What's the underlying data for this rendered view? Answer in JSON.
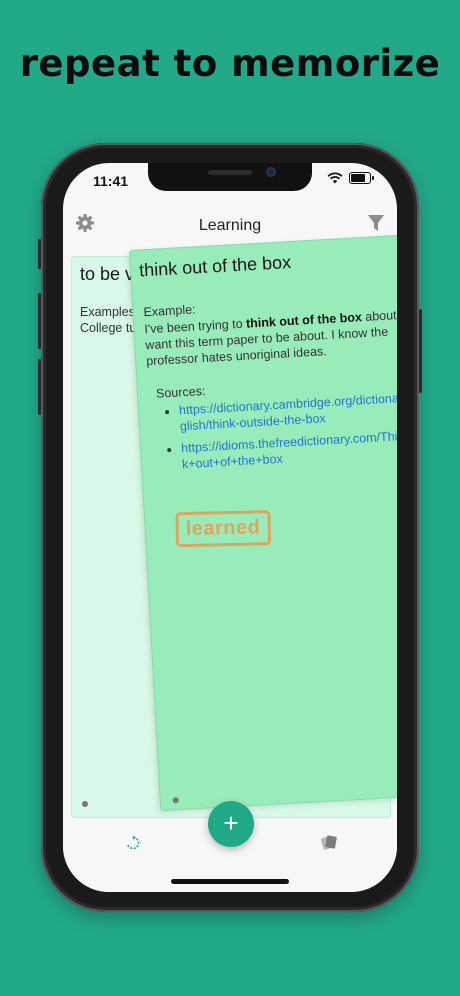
{
  "banner": {
    "headline": "repeat to memorize"
  },
  "status_bar": {
    "time": "11:41"
  },
  "navbar": {
    "title": "Learning",
    "settings_icon": "gear-icon",
    "filter_icon": "filter-icon"
  },
  "back_card": {
    "title_partial": "to be v",
    "body_line1": "Examples",
    "body_line2": "College tu"
  },
  "front_card": {
    "title": "think out of the box",
    "example_label": "Example:",
    "example_prefix": "I've been trying to ",
    "example_bold": "think out of the box",
    "example_suffix": " about what I want this term paper to be about. I know the professor hates unoriginal ideas.",
    "sources_label": "Sources:",
    "sources": [
      "https://dictionary.cambridge.org/dictionary/english/think-outside-the-box",
      "https://idioms.thefreedictionary.com/Think+out+of+the+box"
    ],
    "stamp": "learned"
  },
  "tabbar": {
    "left_icon": "refresh-icon",
    "add_label": "+",
    "right_icon": "cards-icon"
  },
  "colors": {
    "background": "#22a98a",
    "back_card": "#d8f8e8",
    "front_card": "#98ecb9",
    "fab": "#20a987",
    "stamp": "#e2a35d",
    "link": "#2177d6"
  }
}
